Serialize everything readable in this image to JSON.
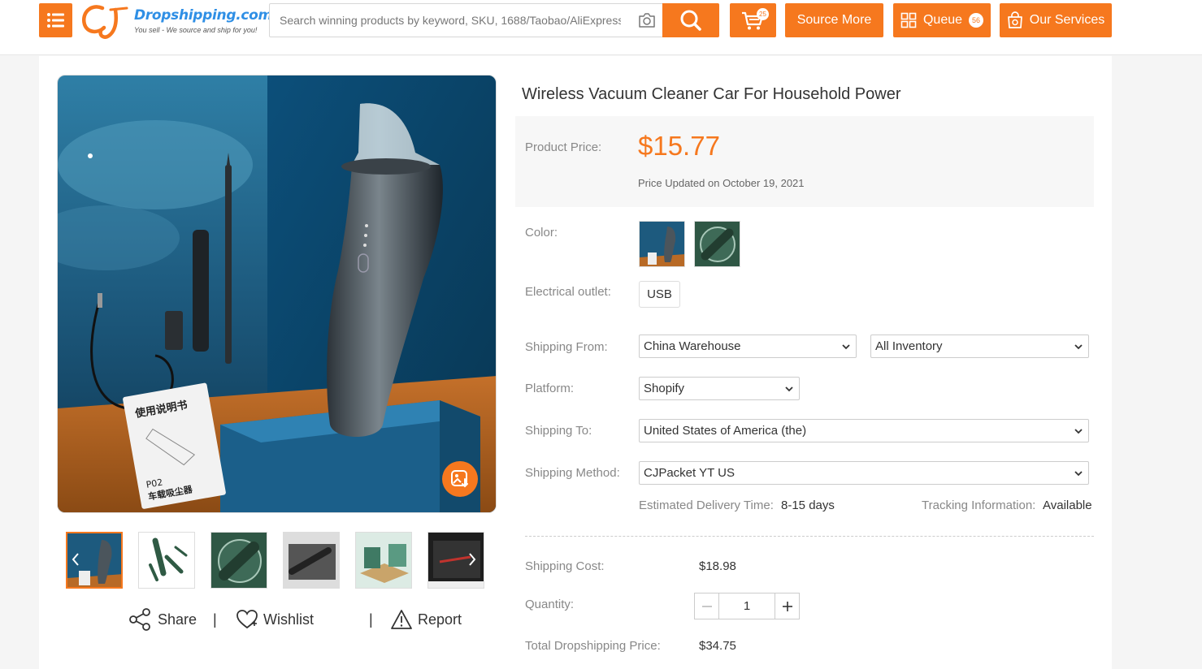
{
  "header": {
    "logo_brand": "Dropshipping.com",
    "logo_slogan": "You sell - We source and ship for you!",
    "search_placeholder": "Search winning products by keyword, SKU, 1688/Taobao/AliExpress URL",
    "cart_count": "25",
    "source_more_label": "Source More",
    "queue_label": "Queue",
    "queue_count": "56",
    "our_services_label": "Our Services"
  },
  "product": {
    "title": "Wireless Vacuum Cleaner Car For Household Power",
    "price_label": "Product Price:",
    "price": "$15.77",
    "price_updated": "Price Updated on October 19, 2021",
    "color_label": "Color:",
    "outlet_label": "Electrical outlet:",
    "outlet_option": "USB",
    "shipping_from_label": "Shipping From:",
    "shipping_from_value": "China Warehouse",
    "inventory_value": "All Inventory",
    "platform_label": "Platform:",
    "platform_value": "Shopify",
    "shipping_to_label": "Shipping To:",
    "shipping_to_value": "United States of America (the)",
    "shipping_method_label": "Shipping Method:",
    "shipping_method_value": "CJPacket YT US",
    "delivery_label": "Estimated Delivery Time:",
    "delivery_value": "8-15 days",
    "tracking_label": "Tracking Information:",
    "tracking_value": "Available",
    "shipping_cost_label": "Shipping Cost:",
    "shipping_cost_value": "$18.98",
    "quantity_label": "Quantity:",
    "quantity_value": "1",
    "total_label": "Total Dropshipping Price:",
    "total_value": "$34.75"
  },
  "image_text": {
    "manual_title": "使用说明书",
    "manual_model": "P02",
    "manual_name": "车载吸尘器"
  },
  "actions": {
    "share": "Share",
    "wishlist": "Wishlist",
    "report": "Report",
    "separator": "|"
  },
  "colors": {
    "accent": "#f6781e",
    "brand_blue": "#2f8fe5",
    "price_bg": "#f7f7f7"
  }
}
